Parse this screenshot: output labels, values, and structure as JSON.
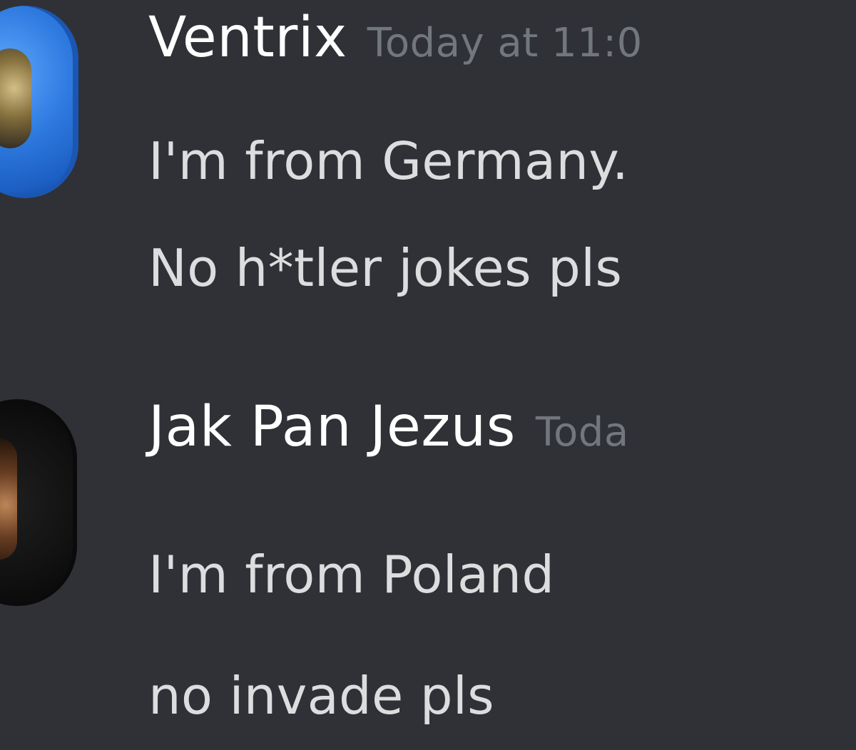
{
  "messages": [
    {
      "username": "Ventrix",
      "timestamp": "Today at 11:0",
      "lines": [
        "I'm from Germany.",
        "No h*tler jokes pls"
      ],
      "avatar_icon": "user-avatar-blue-icon",
      "avatar_color": "#2f7be0"
    },
    {
      "username": "Jak Pan Jezus",
      "timestamp": "Toda",
      "lines": [
        "I'm from Poland",
        "no invade pls"
      ],
      "avatar_icon": "user-avatar-dark-icon",
      "avatar_color": "#121212"
    }
  ],
  "theme": {
    "background": "#2f3136",
    "username_color": "#ffffff",
    "timestamp_color": "#72767d",
    "message_color": "#dcddde"
  }
}
